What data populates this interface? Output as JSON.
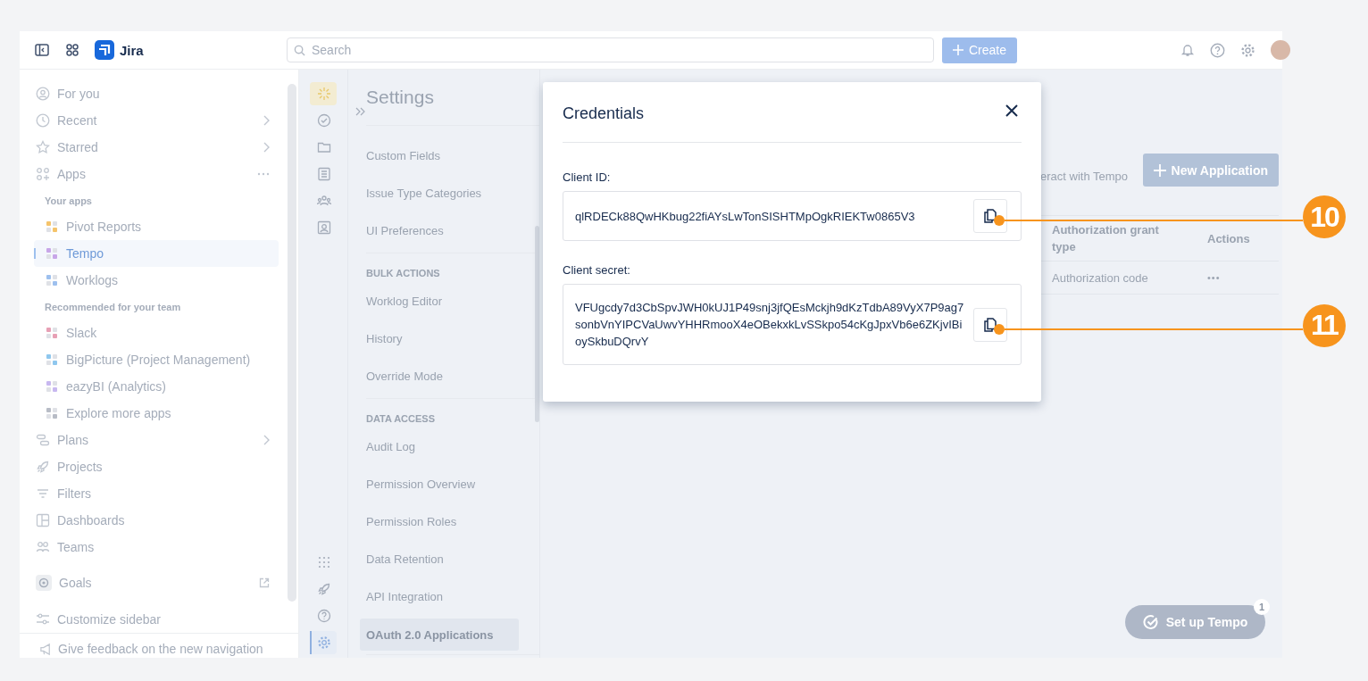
{
  "topbar": {
    "product": "Jira",
    "search": {
      "placeholder": "Search"
    },
    "create_button": "Create"
  },
  "sidebar": {
    "items": [
      {
        "kind": "nav",
        "label": "For you",
        "chevron": false,
        "more": false,
        "selected": false
      },
      {
        "kind": "nav",
        "label": "Recent",
        "chevron": true,
        "more": false,
        "selected": false
      },
      {
        "kind": "nav",
        "label": "Starred",
        "chevron": true,
        "more": false,
        "selected": false
      },
      {
        "kind": "nav",
        "label": "Apps",
        "chevron": false,
        "more": true,
        "selected": false
      },
      {
        "kind": "heading",
        "label": "Your apps"
      },
      {
        "kind": "app",
        "label": "Pivot Reports",
        "selected": false
      },
      {
        "kind": "app",
        "label": "Tempo",
        "selected": true
      },
      {
        "kind": "app",
        "label": "Worklogs",
        "selected": false
      },
      {
        "kind": "heading",
        "label": "Recommended for your team"
      },
      {
        "kind": "app",
        "label": "Slack",
        "selected": false
      },
      {
        "kind": "app",
        "label": "BigPicture (Project Management)",
        "selected": false
      },
      {
        "kind": "app",
        "label": "eazyBI (Analytics)",
        "selected": false
      },
      {
        "kind": "app",
        "label": "Explore more apps",
        "selected": false
      },
      {
        "kind": "nav",
        "label": "Plans",
        "chevron": true,
        "more": false,
        "selected": false
      },
      {
        "kind": "nav",
        "label": "Projects",
        "chevron": false,
        "more": false,
        "selected": false
      },
      {
        "kind": "nav",
        "label": "Filters",
        "chevron": false,
        "more": false,
        "selected": false
      },
      {
        "kind": "nav",
        "label": "Dashboards",
        "chevron": false,
        "more": false,
        "selected": false
      },
      {
        "kind": "nav",
        "label": "Teams",
        "chevron": false,
        "more": false,
        "selected": false
      }
    ],
    "goals": {
      "label": "Goals",
      "external": true
    },
    "customize": "Customize sidebar",
    "feedback": "Give feedback on the new navigation"
  },
  "rail": {
    "top": [
      {
        "selected": false
      },
      {
        "selected": false
      },
      {
        "selected": false
      },
      {
        "selected": false
      },
      {
        "selected": false
      },
      {
        "selected": false
      }
    ],
    "bottom": [
      {
        "selected": false
      },
      {
        "selected": false
      },
      {
        "selected": false
      },
      {
        "selected": true
      }
    ]
  },
  "settings": {
    "title": "Settings",
    "sections": [
      {
        "items": [
          {
            "label": "Custom Fields",
            "selected": false
          },
          {
            "label": "Issue Type Categories",
            "selected": false
          },
          {
            "label": "UI Preferences",
            "selected": false
          }
        ]
      },
      {
        "heading": "BULK ACTIONS",
        "items": [
          {
            "label": "Worklog Editor",
            "selected": false
          },
          {
            "label": "History",
            "selected": false
          },
          {
            "label": "Override Mode",
            "selected": false
          }
        ]
      },
      {
        "heading": "DATA ACCESS",
        "items": [
          {
            "label": "Audit Log",
            "selected": false
          },
          {
            "label": "Permission Overview",
            "selected": false
          },
          {
            "label": "Permission Roles",
            "selected": false
          },
          {
            "label": "Data Retention",
            "selected": false
          },
          {
            "label": "API Integration",
            "selected": false
          },
          {
            "label": "OAuth 2.0 Applications",
            "selected": true
          }
        ]
      }
    ]
  },
  "content": {
    "intro_fragment": "eract with Tempo",
    "new_button": "New Application",
    "table": {
      "columns": [
        "Authorization grant type",
        "Actions"
      ],
      "rows": [
        {
          "grant_type": "Authorization code",
          "actions": "•••"
        }
      ]
    }
  },
  "setup_button": {
    "label": "Set up Tempo",
    "badge": "1"
  },
  "modal": {
    "title": "Credentials",
    "fields": [
      {
        "label": "Client ID:",
        "value": "qlRDECk88QwHKbug22fiAYsLwTonSISHTMpOgkRIEKTw0865V3",
        "callout": "10"
      },
      {
        "label": "Client secret:",
        "value": "VFUgcdy7d3CbSpvJWH0kUJ1P49snj3jfQEsMckjh9dKzTdbA89VyX7P9ag7sonbVnYIPCVaUwvYHHRmooX4eOBekxkLvSSkpo54cKgJpxVb6e6ZKjvIBioySkbuDQrvY",
        "callout": "11"
      }
    ]
  }
}
